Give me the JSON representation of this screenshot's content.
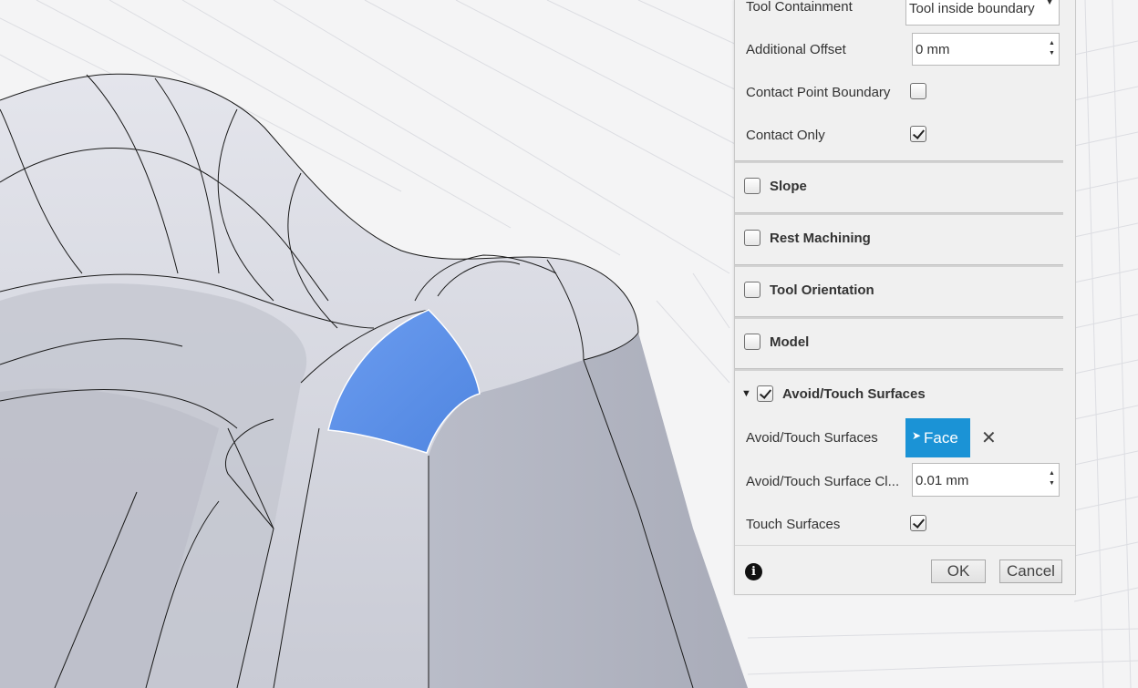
{
  "panel": {
    "tool_containment": {
      "label": "Tool Containment",
      "value": "Tool inside boundary"
    },
    "additional_offset": {
      "label": "Additional Offset",
      "value": "0 mm"
    },
    "contact_point_boundary": {
      "label": "Contact Point Boundary",
      "checked": false
    },
    "contact_only": {
      "label": "Contact Only",
      "checked": true
    },
    "sections": [
      {
        "label": "Slope",
        "checked": false
      },
      {
        "label": "Rest Machining",
        "checked": false
      },
      {
        "label": "Tool Orientation",
        "checked": false
      },
      {
        "label": "Model",
        "checked": false
      }
    ],
    "avoid_touch": {
      "label": "Avoid/Touch Surfaces",
      "checked": true,
      "expanded": true,
      "surfaces_label": "Avoid/Touch Surfaces",
      "face_button": "Face",
      "clearance_label": "Avoid/Touch Surface Cl...",
      "clearance_value": "0.01 mm",
      "touch_label": "Touch Surfaces",
      "touch_checked": true
    },
    "footer": {
      "ok": "OK",
      "cancel": "Cancel"
    }
  },
  "colors": {
    "selected_face": "#6495e8",
    "face_button": "#1b93d6",
    "panel_bg": "#f0f0f0",
    "model_surface": "#c4c6d0"
  },
  "icons": {
    "info": "info-icon",
    "clear": "close-icon",
    "dropdown": "chevron-down-icon",
    "expand": "triangle-down-icon",
    "cursor": "cursor-icon"
  }
}
